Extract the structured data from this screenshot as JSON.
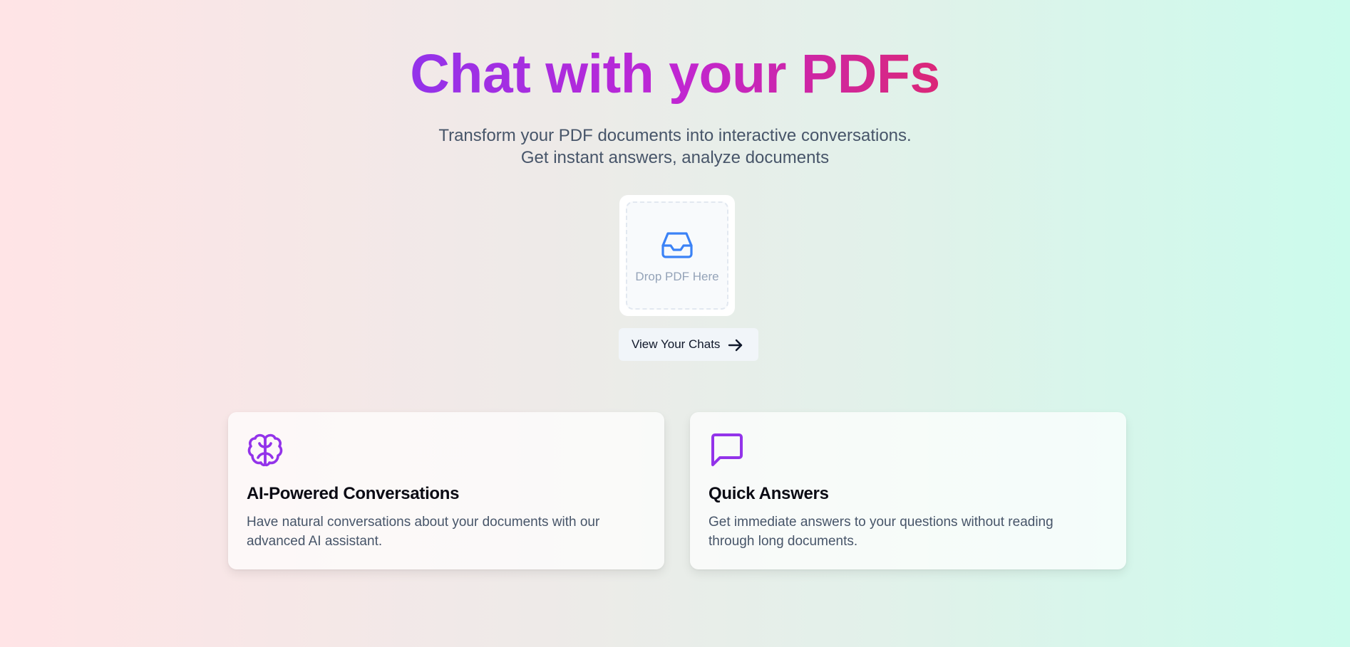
{
  "hero": {
    "title": "Chat with your PDFs",
    "subtitle_line1": "Transform your PDF documents into interactive conversations.",
    "subtitle_line2": "Get instant answers, analyze documents"
  },
  "upload": {
    "icon": "inbox-icon",
    "label": "Drop PDF Here"
  },
  "actions": {
    "view_chats_label": "View Your Chats",
    "view_chats_icon": "arrow-right-icon"
  },
  "features": [
    {
      "icon": "brain-icon",
      "title": "AI-Powered Conversations",
      "description": "Have natural conversations about your documents with our advanced AI assistant."
    },
    {
      "icon": "message-square-icon",
      "title": "Quick Answers",
      "description": "Get immediate answers to your questions without reading through long documents."
    }
  ],
  "colors": {
    "title_gradient_start": "#9333ea",
    "title_gradient_end": "#db2777",
    "upload_icon": "#3b82f6",
    "feature_icon": "#9333ea",
    "background_left": "#ffe4e6",
    "background_right": "#ccfbec"
  }
}
